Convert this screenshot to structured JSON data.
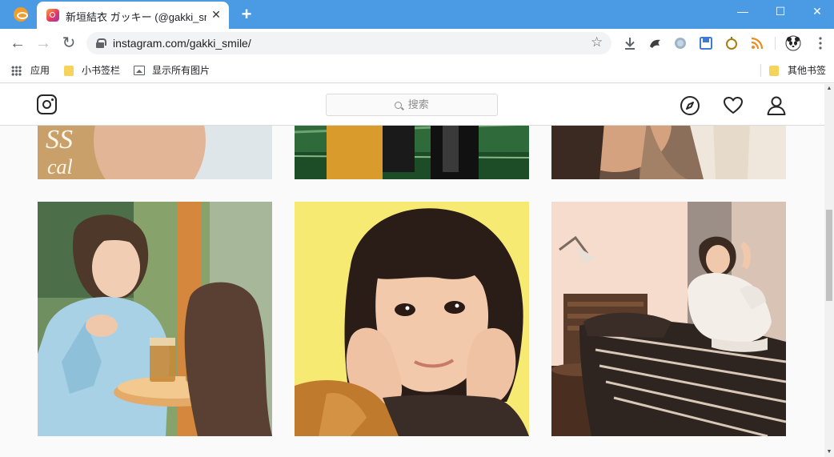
{
  "browser": {
    "tab_title": "新垣結衣 ガッキー (@gakki_smi",
    "tab_close": "✕",
    "new_tab": "+",
    "window_controls": {
      "minimize": "—",
      "maximize": "☐",
      "close": "✕"
    },
    "nav": {
      "back": "←",
      "forward": "→",
      "reload": "↻"
    },
    "url": "instagram.com/gakki_smile/",
    "bookmark_star": "☆",
    "bookmarks": {
      "apps": "应用",
      "folder1": "小书签栏",
      "show_images": "显示所有图片",
      "other": "其他书签"
    },
    "colors": {
      "tab_strip": "#4b9be4",
      "toolbar": "#ffffff"
    }
  },
  "instagram": {
    "search_placeholder": "搜索",
    "icons": [
      "instagram-logo-icon",
      "compass-icon",
      "heart-icon",
      "profile-icon"
    ],
    "posts_row_top": [
      "post-partial-1",
      "post-partial-2",
      "post-partial-3"
    ],
    "posts_row_main": [
      "post-tea-photo",
      "post-portrait-yellow",
      "post-bedroom"
    ],
    "partial_text": {
      "line1": "SS",
      "line2": "cal"
    }
  }
}
